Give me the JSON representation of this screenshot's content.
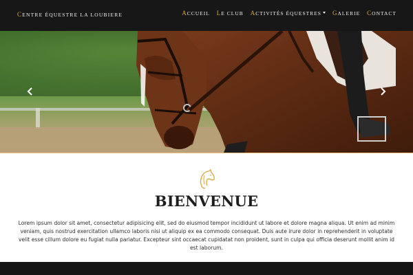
{
  "brand": {
    "first": "C",
    "rest": "entre équestre la loubiere"
  },
  "nav": {
    "items": [
      {
        "first": "A",
        "rest": "ccueil",
        "dropdown": false
      },
      {
        "first": "L",
        "rest": "e Club",
        "dropdown": false
      },
      {
        "first": "A",
        "rest": "ctivités équestres",
        "dropdown": true
      },
      {
        "first": "G",
        "rest": "alerie",
        "dropdown": false
      },
      {
        "first": "C",
        "rest": "ontact",
        "dropdown": false
      }
    ]
  },
  "colors": {
    "nav_bg": "#171717",
    "accent": "#d9a441",
    "text_dark": "#1e1e1e"
  },
  "icons": {
    "prev": "chevron-left-icon",
    "next": "chevron-right-icon",
    "logo": "horse-head-icon"
  },
  "welcome": {
    "title": "BIENVENUE",
    "body": "Lorem ipsum dolor sit amet, consectetur adipisicing elit, sed do eiusmod tempor incididunt ut labore et dolore magna aliqua. Ut enim ad minim veniam, quis nostrud exercitation ullamco laboris nisi ut aliquip ex ea commodo consequat. Duis aute irure dolor in reprehenderit in voluptate velit esse cillum dolore eu fugiat nulla pariatur. Excepteur sint occaecat cupidatat non proident, sunt in culpa qui officia deserunt mollit anim id est laborum."
  }
}
